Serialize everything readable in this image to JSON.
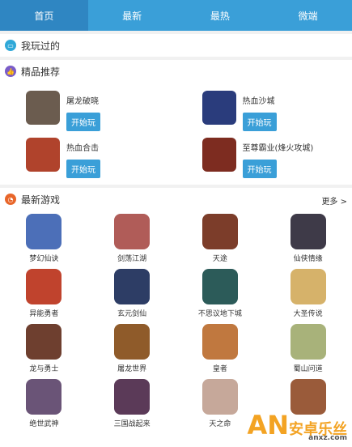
{
  "nav": {
    "tabs": [
      "首页",
      "最新",
      "最热",
      "微端"
    ]
  },
  "played": {
    "title": "我玩过的"
  },
  "recommend": {
    "title": "精品推荐",
    "items": [
      {
        "name": "屠龙破晓",
        "btn": "开始玩",
        "color": "#6b5c4f"
      },
      {
        "name": "热血沙城",
        "btn": "开始玩",
        "color": "#2a3c7c"
      },
      {
        "name": "热血合击",
        "btn": "开始玩",
        "color": "#b0432c"
      },
      {
        "name": "至尊霸业(烽火攻城)",
        "btn": "开始玩",
        "color": "#7d2c20"
      }
    ]
  },
  "latest": {
    "title": "最新游戏",
    "more": "更多 >",
    "games": [
      {
        "name": "梦幻仙诀",
        "color": "#4c6fb8"
      },
      {
        "name": "剑荡江湖",
        "color": "#b05c58"
      },
      {
        "name": "天途",
        "color": "#7c3d2a"
      },
      {
        "name": "仙侠情缘",
        "color": "#3e3a48"
      },
      {
        "name": "异能勇者",
        "color": "#c0432d"
      },
      {
        "name": "玄元剑仙",
        "color": "#2d3d65"
      },
      {
        "name": "不思议地下城",
        "color": "#2c5b59"
      },
      {
        "name": "大圣传说",
        "color": "#d6b26a"
      },
      {
        "name": "龙与勇士",
        "color": "#6e3f2f"
      },
      {
        "name": "屠龙世界",
        "color": "#8f5b2a"
      },
      {
        "name": "皇者",
        "color": "#c0783f"
      },
      {
        "name": "蜀山问道",
        "color": "#a8b27a"
      },
      {
        "name": "绝世武神",
        "color": "#6a5477"
      },
      {
        "name": "三国战起来",
        "color": "#5b3a58"
      },
      {
        "name": "天之命",
        "color": "#c6a89a"
      },
      {
        "name": "",
        "color": "#9a5b3a"
      }
    ]
  },
  "watermark": {
    "an": "AN",
    "cn": "安卓乐丝",
    "url": "anxz.com"
  },
  "colors": {
    "accent": "#3a9fd8",
    "accent_dark": "#2f86c2"
  }
}
